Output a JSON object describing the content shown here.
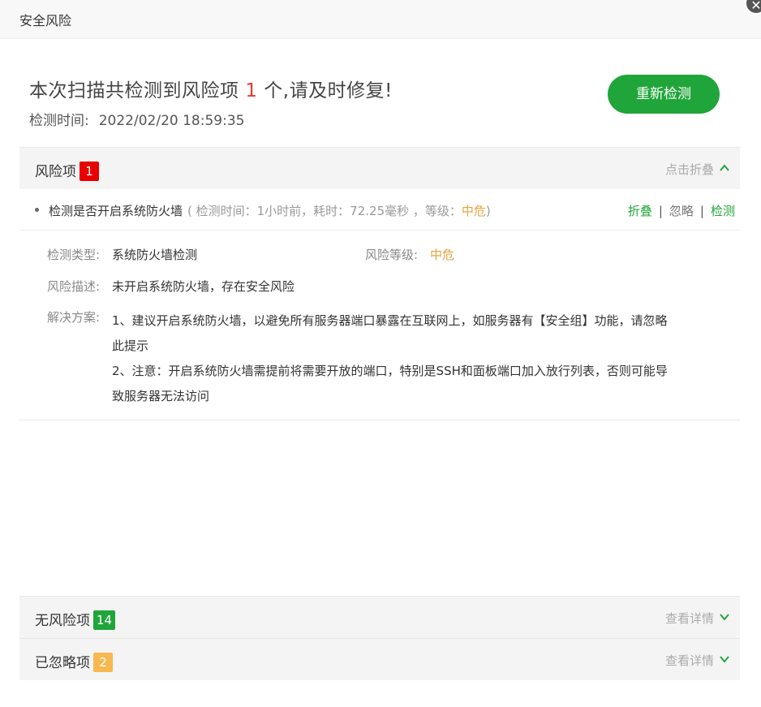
{
  "window": {
    "title": "安全风险",
    "close_glyph": "✕"
  },
  "summary": {
    "headline_prefix": "本次扫描共检测到风险项",
    "risk_count": "1",
    "headline_suffix": "个,请及时修复!",
    "time_label": "检测时间:",
    "time_value": "2022/02/20 18:59:35"
  },
  "rescan_button": "重新检测",
  "risk_section": {
    "label": "风险项",
    "count": "1",
    "toggle_label": "点击折叠"
  },
  "risk_item": {
    "name": "检测是否开启系统防火墙",
    "meta_prefix": "( 检测时间：1小时前，耗时：72.25毫秒 ，等级：",
    "level": "中危",
    "meta_suffix": ")",
    "actions": {
      "fold": "折叠",
      "ignore": "忽略",
      "check": "检测"
    }
  },
  "risk_detail": {
    "type_label": "检测类型:",
    "type_value": "系统防火墙检测",
    "level_label": "风险等级:",
    "level_value": "中危",
    "desc_label": "风险描述:",
    "desc_value": "未开启系统防火墙，存在安全风险",
    "solution_label": "解决方案:",
    "solution_lines": [
      "1、建议开启系统防火墙，以避免所有服务器端口暴露在互联网上，如服务器有【安全组】功能，请忽略",
      "此提示",
      "2、注意：开启系统防火墙需提前将需要开放的端口，特别是SSH和面板端口加入放行列表，否则可能导",
      "致服务器无法访问"
    ]
  },
  "safe_section": {
    "label": "无风险项",
    "count": "14",
    "toggle_label": "查看详情"
  },
  "ignored_section": {
    "label": "已忽略项",
    "count": "2",
    "toggle_label": "查看详情"
  },
  "colors": {
    "accent": "#20a53a",
    "danger": "#e80000",
    "warning": "#e6a23c",
    "ignored_badge": "#f7b851"
  }
}
